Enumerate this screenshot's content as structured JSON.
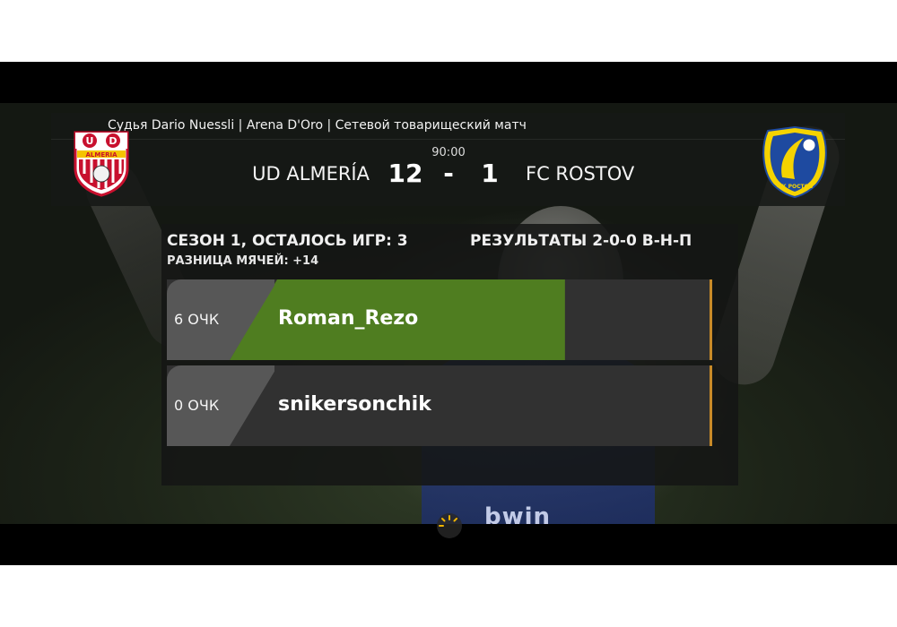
{
  "header": {
    "match_info": "Судья Dario Nuessli | Arena D'Oro | Сетевой товарищеский матч",
    "time": "90:00",
    "home_team": "UD ALMERÍA",
    "home_score": "12",
    "separator": "-",
    "away_score": "1",
    "away_team": "FC ROSTOV",
    "home_logo_icon": "almeria-crest-icon",
    "home_logo_text": "U D ALMERIA",
    "away_logo_icon": "rostov-crest-icon",
    "away_logo_text": "ФК РОСТОВ 1930"
  },
  "season": {
    "title": "СЕЗОН 1, ОСТАЛОСЬ ИГР: 3",
    "goal_diff": "РАЗНИЦА МЯЧЕЙ: +14",
    "results": "РЕЗУЛЬТАТЫ 2-0-0 В-Н-П"
  },
  "standings": [
    {
      "points": "6 ОЧК",
      "name": "Roman_Rezo",
      "progress": 0.73
    },
    {
      "points": "0 ОЧК",
      "name": "snikersonchik",
      "progress": 0.0
    }
  ],
  "background": {
    "sponsor_text": "bwin"
  },
  "colors": {
    "progress_fill": "#4f7d20",
    "accent": "#c88a28",
    "rostov_yellow": "#f5d300",
    "rostov_blue": "#1e4aa0"
  },
  "loading_icon": "loading-spinner-icon"
}
